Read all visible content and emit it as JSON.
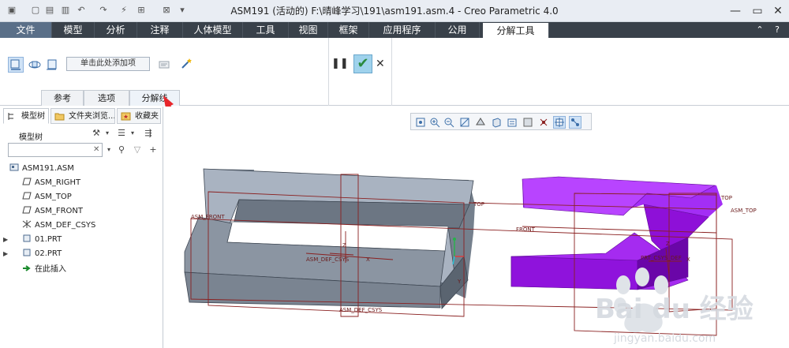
{
  "window": {
    "title": "ASM191 (活动的) F:\\晴峰学习\\191\\asm191.asm.4 - Creo Parametric 4.0"
  },
  "menu": {
    "tabs": [
      "文件",
      "模型",
      "分析",
      "注释",
      "人体模型",
      "工具",
      "视图",
      "框架",
      "应用程序",
      "公用",
      "分解工具"
    ]
  },
  "ribbon": {
    "add_item_label": "单击此处添加项",
    "subtabs": [
      "参考",
      "选项",
      "分解线"
    ]
  },
  "panel": {
    "tabs": [
      "模型树",
      "文件夹浏览...",
      "收藏夹"
    ],
    "tree_header": "模型树",
    "search_placeholder": "",
    "tree": [
      {
        "label": "ASM191.ASM",
        "icon": "assembly-icon"
      },
      {
        "label": "ASM_RIGHT",
        "icon": "datum-plane-icon"
      },
      {
        "label": "ASM_TOP",
        "icon": "datum-plane-icon"
      },
      {
        "label": "ASM_FRONT",
        "icon": "datum-plane-icon"
      },
      {
        "label": "ASM_DEF_CSYS",
        "icon": "csys-icon"
      },
      {
        "label": "01.PRT",
        "icon": "part-icon"
      },
      {
        "label": "02.PRT",
        "icon": "part-icon"
      },
      {
        "label": "在此插入",
        "icon": "insert-arrow-icon"
      }
    ]
  },
  "viewport": {
    "labels": {
      "asm_front": "ASM_FRONT",
      "top": "TOP",
      "front": "FRONT",
      "asm_top": "ASM_TOP",
      "csys_a": "ASM_DEF_CSYS",
      "csys_b": "ASM_DEF_CSYS",
      "csys_c": "PRT_CSYS_DEF",
      "axis_z": "Z",
      "axis_x": "X",
      "axis_y": "Y"
    }
  },
  "watermark": {
    "brand": "Bai du 经验",
    "url": "jingyan.baidu.com"
  },
  "colors": {
    "menubar": "#39414a",
    "part1": "#7f8894",
    "part2": "#9a0fe8",
    "datum": "#8a2020",
    "accent_arrow": "#e8262b"
  }
}
